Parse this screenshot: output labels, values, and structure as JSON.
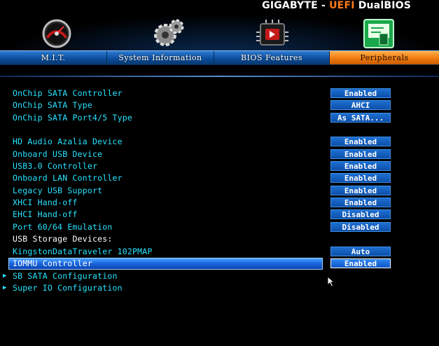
{
  "brand": {
    "name": "GIGABYTE",
    "dash": " - ",
    "product_accent": "UEFI",
    "product": " DualBIOS"
  },
  "tabs": [
    {
      "label": "M.I.T.",
      "icon": "speedometer-icon"
    },
    {
      "label": "System Information",
      "icon": "gears-icon"
    },
    {
      "label": "BIOS Features",
      "icon": "chip-icon"
    },
    {
      "label": "Peripherals",
      "icon": "peripherals-card-icon",
      "active": true
    }
  ],
  "settings": [
    {
      "label": "OnChip SATA Controller",
      "value": "Enabled"
    },
    {
      "label": "OnChip SATA Type",
      "value": "AHCI"
    },
    {
      "label": "OnChip SATA Port4/5 Type",
      "value": "As SATA..."
    },
    {
      "label": "HD Audio Azalia Device",
      "value": "Enabled"
    },
    {
      "label": "Onboard USB Device",
      "value": "Enabled"
    },
    {
      "label": "USB3.0 Controller",
      "value": "Enabled"
    },
    {
      "label": "Onboard LAN Controller",
      "value": "Enabled"
    },
    {
      "label": "Legacy USB Support",
      "value": "Enabled"
    },
    {
      "label": "XHCI Hand-off",
      "value": "Enabled"
    },
    {
      "label": "EHCI Hand-off",
      "value": "Disabled"
    },
    {
      "label": "Port 60/64 Emulation",
      "value": "Disabled"
    },
    {
      "label": "USB Storage Devices:",
      "value": ""
    },
    {
      "label": "KingstonDataTraveler 102PMAP",
      "value": "Auto"
    },
    {
      "label": "IOMMU Controller",
      "value": "Enabled",
      "selected": true
    },
    {
      "label": "SB SATA Configuration",
      "value": "",
      "submenu": true
    },
    {
      "label": "Super IO Configuration",
      "value": "",
      "submenu": true
    }
  ],
  "submenu_arrow": "▶",
  "colors": {
    "label": "#27e4ff",
    "value_bg": "#1d6fd1",
    "tab_bar": "#0b4b9a",
    "active_tab": "#f07a10",
    "brand_accent": "#ff7a1a"
  }
}
